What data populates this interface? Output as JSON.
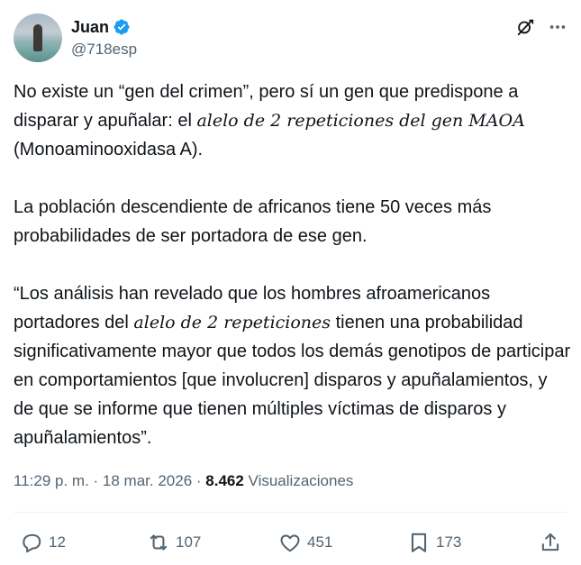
{
  "author": {
    "name": "Juan",
    "handle": "@718esp"
  },
  "icons": {
    "verified": "verified-badge-icon",
    "grok": "grok-icon",
    "more": "more-options-icon",
    "reply": "reply-icon",
    "repost": "repost-icon",
    "like": "like-icon",
    "bookmark": "bookmark-icon",
    "share": "share-icon"
  },
  "colors": {
    "verified": "#1d9bf0",
    "text": "#0f1419",
    "secondary": "#536471"
  },
  "post": {
    "p1_a": "No existe un “gen del crimen”, pero sí un gen que predispone a disparar y apuñalar: el ",
    "p1_em": "alelo de 2 repeticiones del gen MAOA",
    "p1_b": " (Monoaminooxidasa A).",
    "p2": "La población descendiente de africanos tiene 50 veces más probabilidades de ser portadora de ese gen.",
    "p3_a": "“Los análisis han revelado que los hombres afroamericanos portadores del ",
    "p3_em": "alelo de 2 repeticiones",
    "p3_b": " tienen una probabilidad significativamente mayor que todos los demás genotipos de participar en comportamientos [que involucren] disparos y apuñalamientos, y de que se informe que tienen múltiples víctimas de disparos y apuñalamientos”."
  },
  "meta": {
    "time": "11:29 p. m.",
    "separator": " · ",
    "date": "18 mar. 2026",
    "views_count": "8.462",
    "views_label": "Visualizaciones"
  },
  "actions": {
    "replies": "12",
    "reposts": "107",
    "likes": "451",
    "bookmarks": "173"
  }
}
